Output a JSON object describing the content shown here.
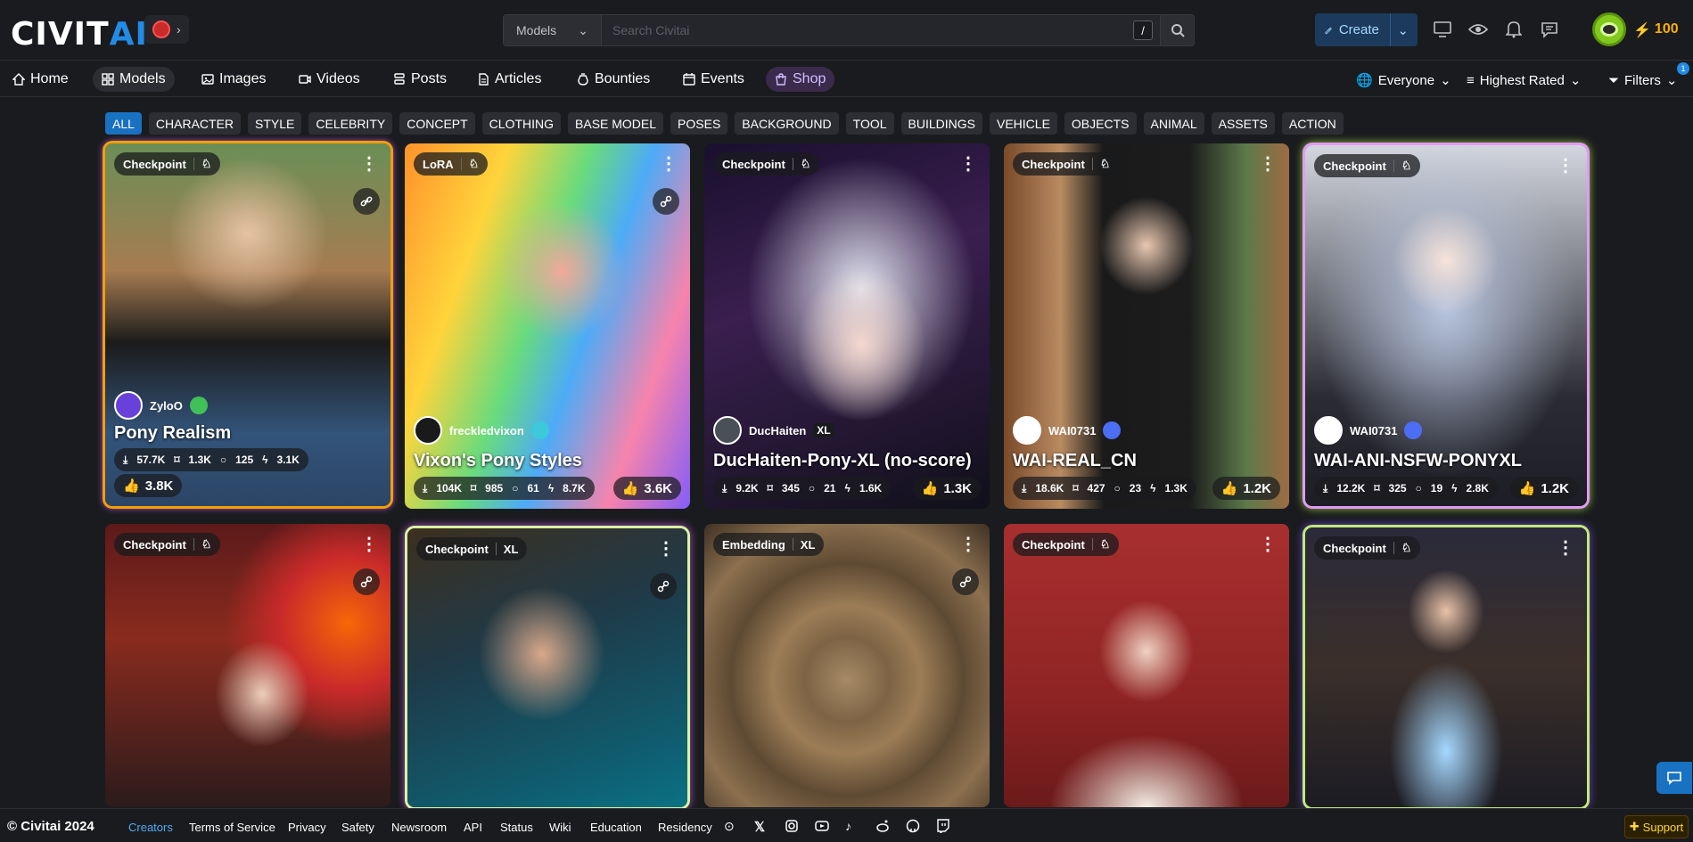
{
  "header": {
    "logo_civ": "CIVIT",
    "logo_ai": "AI",
    "search_category": "Models",
    "search_placeholder": "Search Civitai",
    "search_shortcut": "/",
    "create_label": "Create",
    "buzz_amount": "100"
  },
  "nav": {
    "items": [
      {
        "label": "Home",
        "icon": "home-icon"
      },
      {
        "label": "Models",
        "icon": "models-icon"
      },
      {
        "label": "Images",
        "icon": "image-icon"
      },
      {
        "label": "Videos",
        "icon": "video-icon"
      },
      {
        "label": "Posts",
        "icon": "posts-icon"
      },
      {
        "label": "Articles",
        "icon": "article-icon"
      },
      {
        "label": "Bounties",
        "icon": "bounty-icon"
      },
      {
        "label": "Events",
        "icon": "calendar-icon"
      },
      {
        "label": "Shop",
        "icon": "shop-icon"
      }
    ],
    "browsing_level": "Everyone",
    "sort": "Highest Rated",
    "filters": "Filters",
    "filter_count": "1"
  },
  "categories": [
    "ALL",
    "CHARACTER",
    "STYLE",
    "CELEBRITY",
    "CONCEPT",
    "CLOTHING",
    "BASE MODEL",
    "POSES",
    "BACKGROUND",
    "TOOL",
    "BUILDINGS",
    "VEHICLE",
    "OBJECTS",
    "ANIMAL",
    "ASSETS",
    "ACTION"
  ],
  "cards": [
    {
      "type": "Checkpoint",
      "creator": "ZyloO",
      "title": "Pony Realism",
      "downloads": "57.7K",
      "saves": "1.3K",
      "comments": "125",
      "buzz": "3.1K",
      "likes": "3.8K"
    },
    {
      "type": "LoRA",
      "creator": "freckledvixon",
      "title": "Vixon's Pony Styles",
      "downloads": "104K",
      "saves": "985",
      "comments": "61",
      "buzz": "8.7K",
      "likes": "3.6K"
    },
    {
      "type": "Checkpoint",
      "creator": "DucHaiten",
      "title": "DucHaiten-Pony-XL (no-score)",
      "downloads": "9.2K",
      "saves": "345",
      "comments": "21",
      "buzz": "1.6K",
      "likes": "1.3K",
      "base": "XL"
    },
    {
      "type": "Checkpoint",
      "creator": "WAI0731",
      "title": "WAI-REAL_CN",
      "downloads": "18.6K",
      "saves": "427",
      "comments": "23",
      "buzz": "1.3K",
      "likes": "1.2K"
    },
    {
      "type": "Checkpoint",
      "creator": "WAI0731",
      "title": "WAI-ANI-NSFW-PONYXL",
      "downloads": "12.2K",
      "saves": "325",
      "comments": "19",
      "buzz": "2.8K",
      "likes": "1.2K"
    },
    {
      "type": "Checkpoint"
    },
    {
      "type": "Checkpoint",
      "base": "XL"
    },
    {
      "type": "Embedding",
      "base": "XL"
    },
    {
      "type": "Checkpoint"
    },
    {
      "type": "Checkpoint"
    }
  ],
  "footer": {
    "copyright": "© Civitai 2024",
    "links": [
      "Creators",
      "Terms of Service",
      "Privacy",
      "Safety",
      "Newsroom",
      "API",
      "Status",
      "Wiki",
      "Education",
      "Residency"
    ],
    "support": "Support"
  }
}
